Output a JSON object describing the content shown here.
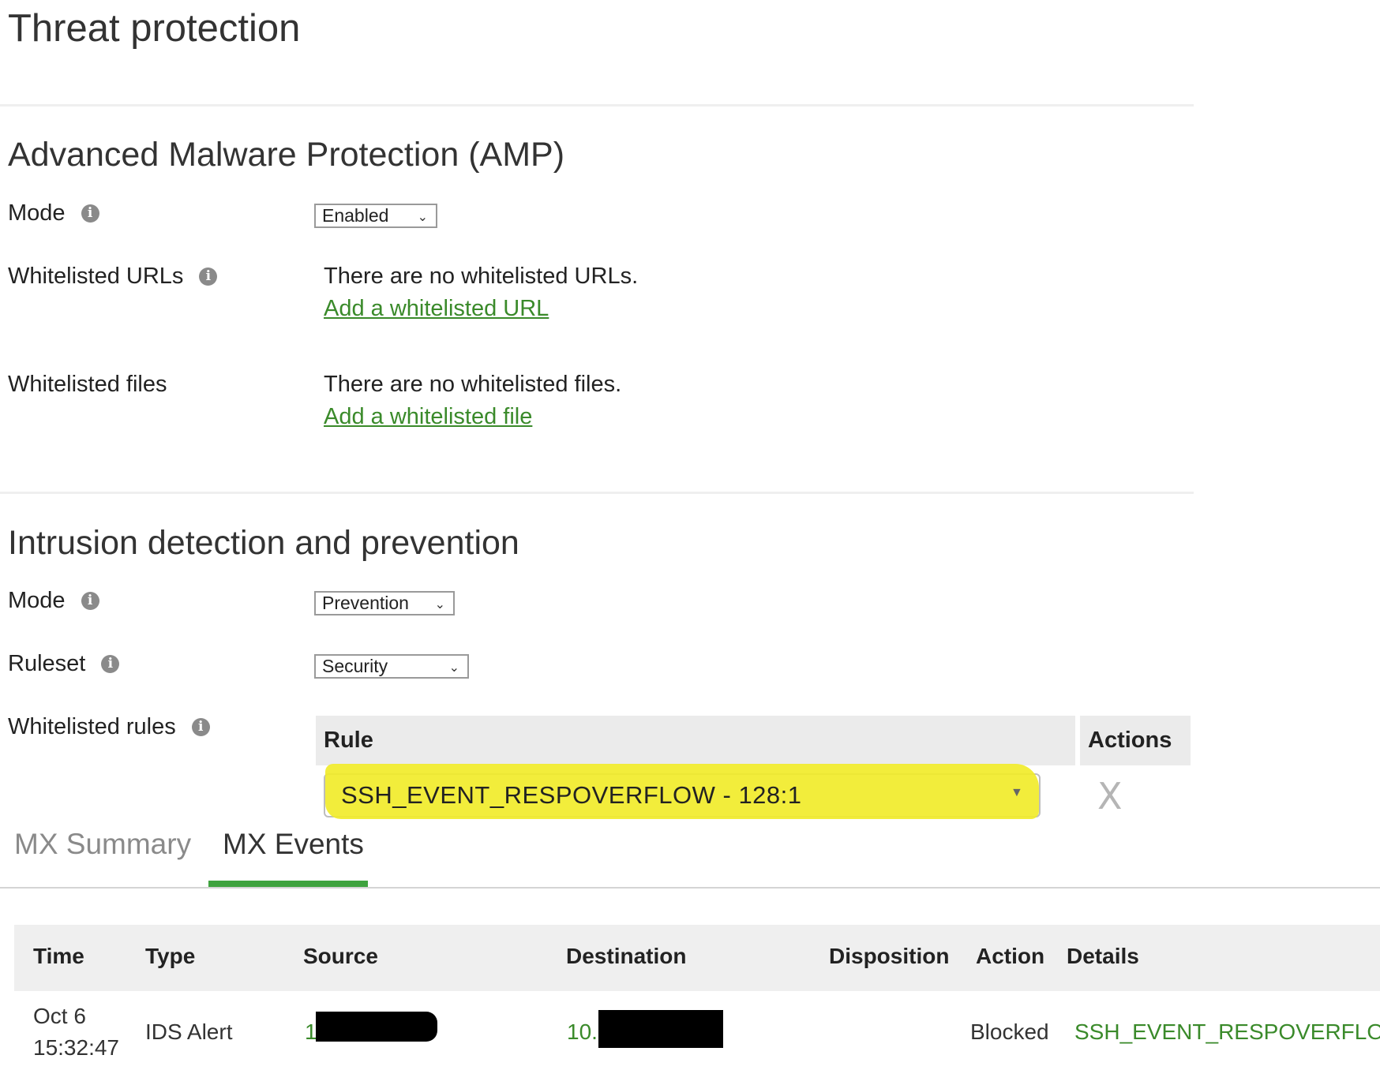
{
  "page_title": "Threat protection",
  "amp": {
    "title": "Advanced Malware Protection (AMP)",
    "mode_label": "Mode",
    "mode_value": "Enabled",
    "urls_label": "Whitelisted URLs",
    "urls_empty": "There are no whitelisted URLs.",
    "urls_add": "Add a whitelisted URL",
    "files_label": "Whitelisted files",
    "files_empty": "There are no whitelisted files.",
    "files_add": "Add a whitelisted file"
  },
  "ids": {
    "title": "Intrusion detection and prevention",
    "mode_label": "Mode",
    "mode_value": "Prevention",
    "ruleset_label": "Ruleset",
    "ruleset_value": "Security",
    "rules_label": "Whitelisted rules",
    "rules_table": {
      "col_rule": "Rule",
      "col_actions": "Actions",
      "rows": [
        {
          "rule": "SSH_EVENT_RESPOVERFLOW - 128:1",
          "delete": "X"
        }
      ]
    }
  },
  "tabs": [
    {
      "label": "MX Summary",
      "active": false
    },
    {
      "label": "MX Events",
      "active": true
    }
  ],
  "events": {
    "columns": [
      "Time",
      "Type",
      "Source",
      "Destination",
      "Disposition",
      "Action",
      "Details"
    ],
    "rows": [
      {
        "time_date": "Oct 6",
        "time_clock": "15:32:47",
        "type": "IDS Alert",
        "source_visible": "1",
        "destination_visible": "10.",
        "disposition": "",
        "action": "Blocked",
        "details": "SSH_EVENT_RESPOVERFLOW"
      }
    ]
  },
  "colors": {
    "link_green": "#3a8a2a",
    "tab_active_underline": "#3fa33f",
    "highlight_yellow": "#f1ec2a",
    "table_header_bg": "#ebebeb"
  }
}
